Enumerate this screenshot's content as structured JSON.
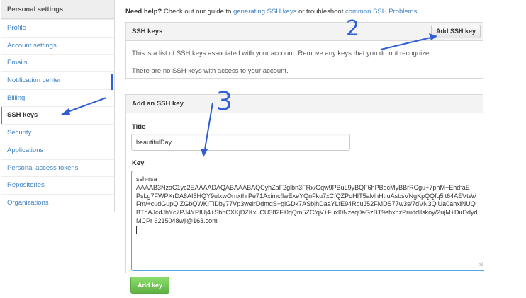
{
  "sidebar": {
    "header": "Personal settings",
    "items": [
      {
        "label": "Profile"
      },
      {
        "label": "Account settings"
      },
      {
        "label": "Emails"
      },
      {
        "label": "Notification center"
      },
      {
        "label": "Billing"
      },
      {
        "label": "SSH keys",
        "active": true
      },
      {
        "label": "Security"
      },
      {
        "label": "Applications"
      },
      {
        "label": "Personal access tokens"
      },
      {
        "label": "Repositories"
      },
      {
        "label": "Organizations"
      }
    ]
  },
  "help": {
    "lead": "Need help?",
    "text1": " Check out our guide to ",
    "link1": "generating SSH keys",
    "text2": " or troubleshoot ",
    "link2": "common SSH Problems"
  },
  "ssh_keys": {
    "title": "SSH keys",
    "add_button": "Add SSH key",
    "description": "This is a list of SSH keys associated with your account. Remove any keys that you do not recognize.",
    "empty_message": "There are no SSH keys with access to your account."
  },
  "add_key_form": {
    "title": "Add an SSH key",
    "title_label": "Title",
    "title_value": "beautifulDay",
    "key_label": "Key",
    "key_lines": [
      "ssh-rsa",
      "AAAAB3NzaC1yc2EAAAADAQABAAABAQCyhZaF2glbn3FRx/Gqw9PBuL9yBQF6hPBqcMyBBrRCgu+7phM+EhdfaE",
      "PsLg7FWPXrDA8AI5HQY9ulxwOrnxthrPe71AximcflwExeYQnFku7xCfQZPoHIT5aMhHtIuAsbsVNgKpQQfq5lt64AEVtW/",
      "Fm/+cudGupQIZGbQWKlTlDby77Vp3welrDdmqS+glGDk7ASbjhDaaYLfE94RguJ52FMDS77w3s/7dVN3QlUa0ahxlNUQ",
      "BTdAJcdJhYc7PJ4YPIUj4+SbnCXKjDZKxLCU382Fl0qQm5ZC/qV+Fuxl0Nzeq0aGzBT9ehxhzPruddllskoy/2ujM+DuDdyd",
      "MCPr 6215048wjl@163.com"
    ],
    "submit_button": "Add key"
  },
  "annotations": {
    "marker_2": "2",
    "marker_3": "3",
    "color": "#2f5ed6"
  }
}
